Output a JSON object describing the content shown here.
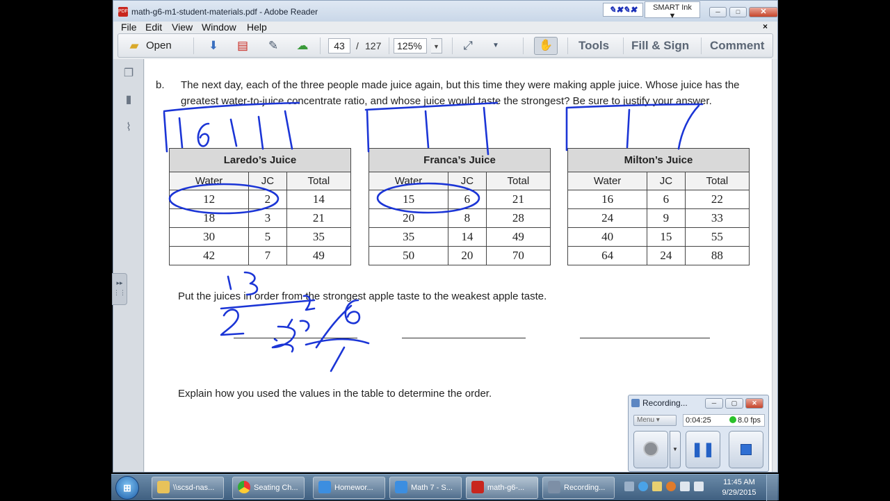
{
  "window": {
    "title": "math-g6-m1-student-materials.pdf - Adobe Reader",
    "smart_ink_label": "SMART Ink",
    "pen_icons": "✎✖✎✖",
    "min_label": "─",
    "max_label": "□",
    "close_label": "✕"
  },
  "menu": [
    "File",
    "Edit",
    "View",
    "Window",
    "Help"
  ],
  "menu_close": "×",
  "toolbar": {
    "open_label": "Open",
    "page_current": "43",
    "page_sep": "/",
    "page_total": "127",
    "zoom": "125%",
    "tools": "Tools",
    "fill_sign": "Fill & Sign",
    "comment": "Comment"
  },
  "sidepanel_tab": "▸▸",
  "document": {
    "question_label": "b.",
    "question": "The next day, each of the three people made juice again, but this time they were making apple juice.  Whose juice has the greatest water-to-juice concentrate ratio, and whose juice would taste the strongest?  Be sure to justify your answer.",
    "order_prompt": "Put the juices in order from the strongest apple taste to the weakest apple taste.",
    "explain_prompt": "Explain how you used the values in the table to determine the order."
  },
  "tables": [
    {
      "title": "Laredo’s Juice",
      "headers": [
        "Water",
        "JC",
        "Total"
      ],
      "rows": [
        [
          "12",
          "2",
          "14"
        ],
        [
          "18",
          "3",
          "21"
        ],
        [
          "30",
          "5",
          "35"
        ],
        [
          "42",
          "7",
          "49"
        ]
      ]
    },
    {
      "title": "Franca’s Juice",
      "headers": [
        "Water",
        "JC",
        "Total"
      ],
      "rows": [
        [
          "15",
          "6",
          "21"
        ],
        [
          "20",
          "8",
          "28"
        ],
        [
          "35",
          "14",
          "49"
        ],
        [
          "50",
          "20",
          "70"
        ]
      ]
    },
    {
      "title": "Milton’s Juice",
      "headers": [
        "Water",
        "JC",
        "Total"
      ],
      "rows": [
        [
          "16",
          "6",
          "22"
        ],
        [
          "24",
          "9",
          "33"
        ],
        [
          "40",
          "15",
          "55"
        ],
        [
          "64",
          "24",
          "88"
        ]
      ]
    }
  ],
  "recording": {
    "title": "Recording...",
    "menu": "Menu",
    "elapsed": "0:04:25",
    "fps": "8.0 fps"
  },
  "taskbar": {
    "tasks": [
      "\\\\scsd-nas...",
      "Seating Ch...",
      "Homewor...",
      "Math 7 - S...",
      "math-g6-...",
      "Recording..."
    ],
    "time": "11:45 AM",
    "date": "9/29/2015"
  },
  "colors": {
    "ink": "#1b35d6",
    "accent_pdf": "#c8261e",
    "table_header": "#d9d9d9"
  }
}
